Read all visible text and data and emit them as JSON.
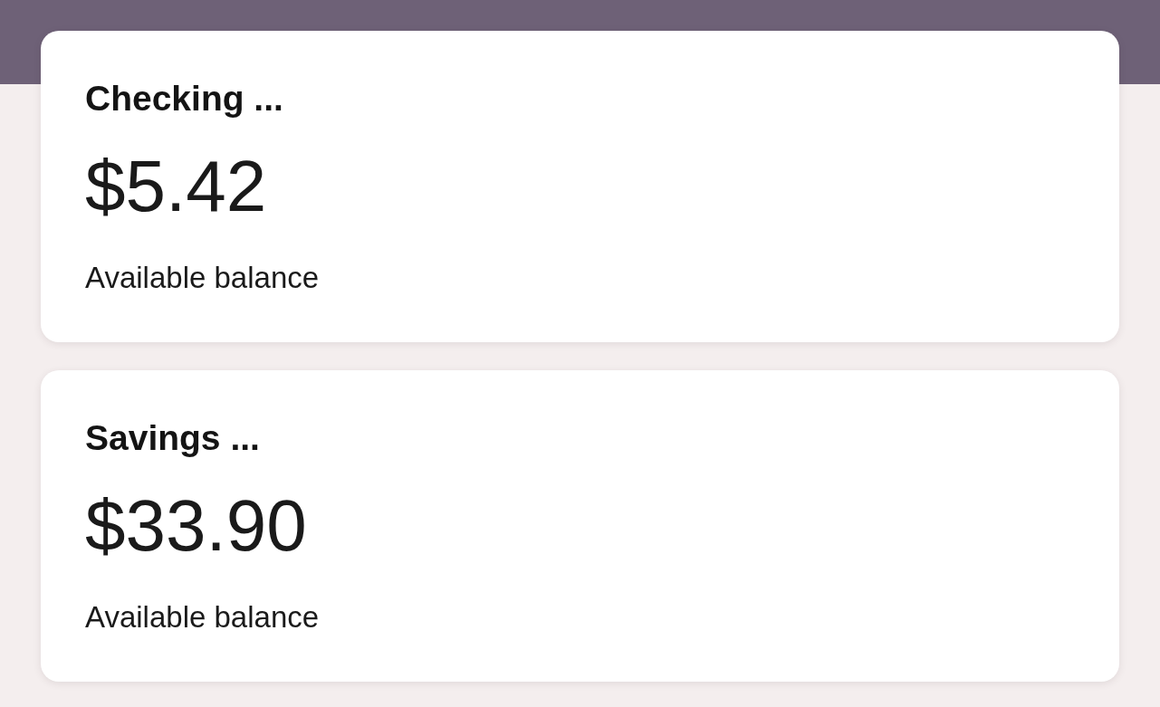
{
  "accounts": [
    {
      "name": "Checking ...",
      "balance": "$5.42",
      "balance_label": "Available balance"
    },
    {
      "name": "Savings ...",
      "balance": "$33.90",
      "balance_label": "Available balance"
    }
  ]
}
